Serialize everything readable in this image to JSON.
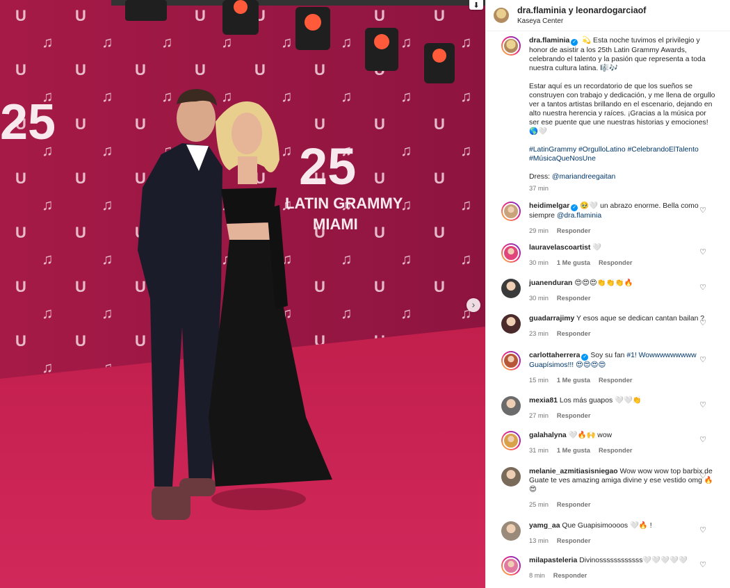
{
  "photo": {
    "download_icon": "download-icon",
    "next_icon": "chevron-right-icon",
    "backdrop_color": "#9c1742",
    "carpet_color": "#c4224f",
    "logo_banner_main": "LATIN GRAMMY",
    "logo_banner_city": "MIAMI",
    "logo_banner_number": "25"
  },
  "header": {
    "username": "dra.flaminia y leonardogarciaof",
    "location": "Kaseya Center"
  },
  "caption": {
    "username": "dra.flaminia",
    "verified_icon": "verified-badge-icon",
    "paragraph1": "💫 Esta noche tuvimos el privilegio y honor de asistir a los 25th Latin Grammy Awards, celebrando el talento y la pasión que representa a toda nuestra cultura latina. 🎼🎶",
    "paragraph2": "Estar aquí es un recordatorio de que los sueños se construyen con trabajo y dedicación, y me llena de orgullo ver a tantos artistas brillando en el escenario, dejando en alto nuestra herencia y raíces. ¡Gracias a la música por ser ese puente que une nuestras historias y emociones! 🌎🤍",
    "hashtags": "#LatinGrammy #OrgulloLatino #CelebrandoElTalento #MúsicaQueNosUne",
    "dress_label": "Dress: ",
    "dress_mention": "@mariandreegaitan",
    "time": "37 min"
  },
  "comments": [
    {
      "user": "heidimelgar",
      "verified": true,
      "text": "🥹🤍 un abrazo enorme. Bella como siempre ",
      "mention": "@dra.flaminia",
      "time": "29 min",
      "likes": "",
      "reply": "Responder",
      "avatar_color": "#c9a37a"
    },
    {
      "user": "lauravelascoartist",
      "verified": false,
      "text": "🤍",
      "mention": "",
      "time": "30 min",
      "likes": "1 Me gusta",
      "reply": "Responder",
      "avatar_color": "#e0457b"
    },
    {
      "user": "juanenduran",
      "verified": false,
      "text": "😍😍😍👏👏👏🔥",
      "mention": "",
      "time": "30 min",
      "likes": "",
      "reply": "Responder",
      "avatar_color": "#3a3a3a"
    },
    {
      "user": "guadarrajimy",
      "verified": false,
      "text": "Y esos aque se dedican cantan bailan ?",
      "mention": "",
      "time": "23 min",
      "likes": "",
      "reply": "Responder",
      "avatar_color": "#4a2a2a"
    },
    {
      "user": "carlottaherrera",
      "verified": true,
      "text": "Soy su fan ",
      "mention": "#1! Wowwwwwwwww Guapísimos!!! 😍😍😍😍",
      "time": "15 min",
      "likes": "1 Me gusta",
      "reply": "Responder",
      "avatar_color": "#b8563a"
    },
    {
      "user": "mexia81",
      "verified": false,
      "text": "Los más guapos 🤍🤍👏",
      "mention": "",
      "time": "27 min",
      "likes": "",
      "reply": "Responder",
      "avatar_color": "#6b6b6b"
    },
    {
      "user": "galahalyna",
      "verified": false,
      "text": "🤍🔥🙌 wow",
      "mention": "",
      "time": "31 min",
      "likes": "1 Me gusta",
      "reply": "Responder",
      "avatar_color": "#d9a24a"
    },
    {
      "user": "melanie_azmitiasisniegao",
      "verified": false,
      "text": "Wow wow wow top barbix de Guate te ves amazing amiga divine y ese vestido omg 🔥😍",
      "mention": "",
      "time": "25 min",
      "likes": "",
      "reply": "Responder",
      "avatar_color": "#7a6a5a"
    },
    {
      "user": "yamg_aa",
      "verified": false,
      "text": "Que Guapisimoooos 🤍🔥 !",
      "mention": "",
      "time": "13 min",
      "likes": "",
      "reply": "Responder",
      "avatar_color": "#9a8a7a"
    },
    {
      "user": "milapasteleria",
      "verified": false,
      "text": "Divinossssssssssss🤍🤍🤍🤍🤍",
      "mention": "",
      "time": "8 min",
      "likes": "",
      "reply": "Responder",
      "avatar_color": "#e07aa0"
    }
  ]
}
